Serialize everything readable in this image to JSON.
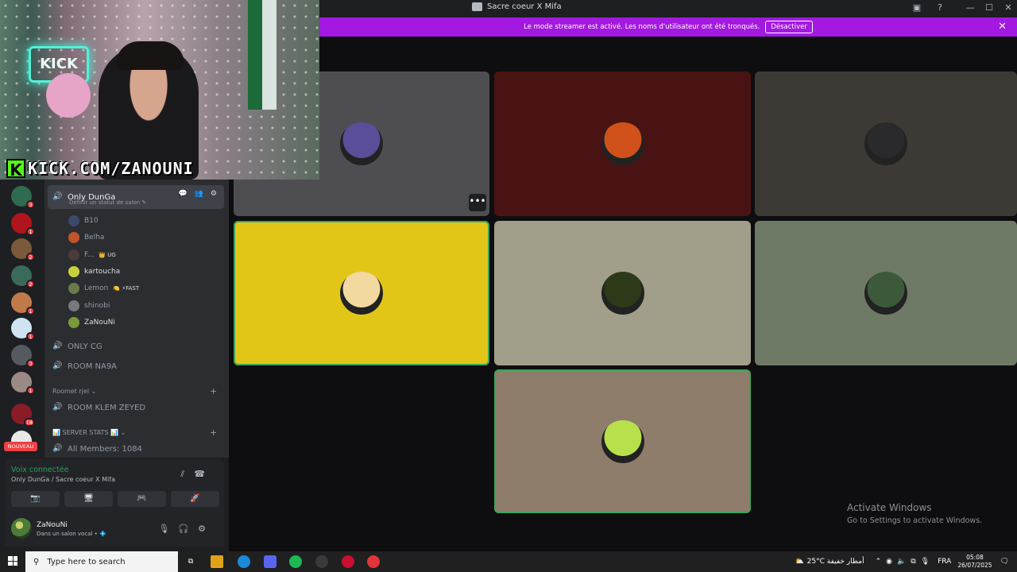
{
  "window": {
    "title": "Sacre coeur X Mifa",
    "controls": [
      "—",
      "☐",
      "✕"
    ]
  },
  "banner": {
    "text": "Le mode streamer est activé. Les noms d'utilisateur ont été tronqués.",
    "button": "Désactiver",
    "close": "✕"
  },
  "webcam": {
    "neon_sign": "KICK",
    "overlay_logo": "K",
    "overlay_text": "KICK.COM/ZANOUNI"
  },
  "servers": [
    {
      "badge": "3",
      "color": "#2f6b4f"
    },
    {
      "badge": "1",
      "color": "#b0141c"
    },
    {
      "badge": "2",
      "color": "#7a5a3a"
    },
    {
      "badge": "2",
      "color": "#3a6a5a"
    },
    {
      "badge": "1",
      "color": "#c07a4a"
    },
    {
      "badge": "1",
      "color": "#cfe3f2"
    },
    {
      "badge": "3",
      "color": "#555a60"
    },
    {
      "badge": "1",
      "color": "#9a8a86"
    },
    {
      "badge": "18",
      "color": "#8a1c28"
    },
    {
      "badge": "",
      "color": "#e8e8e8"
    }
  ],
  "nouveau": "NOUVEAU",
  "channels": {
    "active": {
      "name": "Only DunGa",
      "status": "Définir un statut de salon ✎",
      "tools": "💬 👥 ⚙"
    },
    "members": [
      {
        "name": "B10",
        "tag": "",
        "online": false,
        "color": "#3b4a6b"
      },
      {
        "name": "Belha",
        "tag": "",
        "online": false,
        "color": "#c0542a"
      },
      {
        "name": "F...",
        "tag": "👑 UG",
        "online": false,
        "color": "#4a3a3a"
      },
      {
        "name": "kartoucha",
        "tag": "",
        "online": true,
        "color": "#c9d13a"
      },
      {
        "name": "Lemon",
        "tag": "🍋 ⚡FAST",
        "online": false,
        "color": "#6a7a4a"
      },
      {
        "name": "shinobi",
        "tag": "",
        "online": false,
        "color": "#777a7c"
      },
      {
        "name": "ZaNouNi",
        "tag": "",
        "online": true,
        "color": "#7a9a3a"
      }
    ],
    "others": [
      "ONLY CG",
      "ROOM NA9A"
    ],
    "category1": "Roomet rjel ⌄",
    "room_klem": "ROOM KLEM ZEYED",
    "category2": "📊 SERVER STATS 📊 ⌄",
    "all_members": "All Members: 1084",
    "plus": "+"
  },
  "voice": {
    "status": "Voix connectée",
    "where": "Only DunGa / Sacre coeur X Mifa",
    "buttons": [
      "📷",
      "🖥",
      "🎮",
      "🚀"
    ]
  },
  "user": {
    "name": "ZaNouNi",
    "status": "Dans un salon vocal • 💠"
  },
  "tiles": [
    {
      "bg": "#4e4e52",
      "avatar": "#5a4d9a",
      "speaking": false,
      "more": "•••"
    },
    {
      "bg": "#4a1313",
      "avatar": "#d0521a",
      "speaking": false
    },
    {
      "bg": "#3d3a36",
      "avatar": "#2a2a2c",
      "speaking": false
    },
    {
      "bg": "#e2c617",
      "avatar": "#f2d9a0",
      "speaking": true
    },
    {
      "bg": "#a19e89",
      "avatar": "#2d3a1a",
      "speaking": false
    },
    {
      "bg": "#6e7a66",
      "avatar": "#3c5a3a",
      "speaking": false
    },
    {
      "bg": "#8e7d6b",
      "avatar": "#b8e04a",
      "speaking": true
    }
  ],
  "activate": {
    "title": "Activate Windows",
    "subtitle": "Go to Settings to activate Windows."
  },
  "taskbar": {
    "search": "Type here to search",
    "weather": "25°C  أمطار خفيفة",
    "lang": "FRA",
    "time": "05:08",
    "date": "26/07/2025"
  }
}
